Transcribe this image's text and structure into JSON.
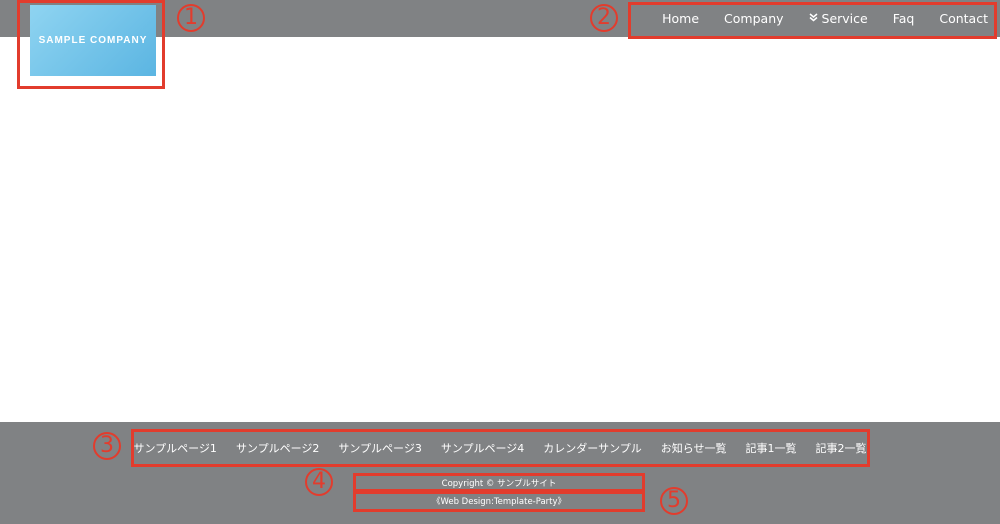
{
  "header": {
    "logo_text": "SAMPLE COMPANY",
    "nav": [
      {
        "label": "Home"
      },
      {
        "label": "Company"
      },
      {
        "label": "Service",
        "icon": "double-chevron-down-icon"
      },
      {
        "label": "Faq"
      },
      {
        "label": "Contact"
      }
    ]
  },
  "footer": {
    "links": [
      {
        "label": "サンプルページ1"
      },
      {
        "label": "サンプルページ2"
      },
      {
        "label": "サンプルページ3"
      },
      {
        "label": "サンプルページ4"
      },
      {
        "label": "カレンダーサンプル"
      },
      {
        "label": "お知らせ一覧"
      },
      {
        "label": "記事1一覧"
      },
      {
        "label": "記事2一覧"
      }
    ],
    "copyright": "Copyright © サンプルサイト",
    "credit": "《Web Design:Template-Party》"
  },
  "annotations": [
    {
      "number": "1"
    },
    {
      "number": "2"
    },
    {
      "number": "3"
    },
    {
      "number": "4"
    },
    {
      "number": "5"
    }
  ],
  "colors": {
    "bar": "#808284",
    "annotation": "#e23c2d",
    "logo_gradient_start": "#8fd4f1",
    "logo_gradient_end": "#5bb5e2"
  }
}
